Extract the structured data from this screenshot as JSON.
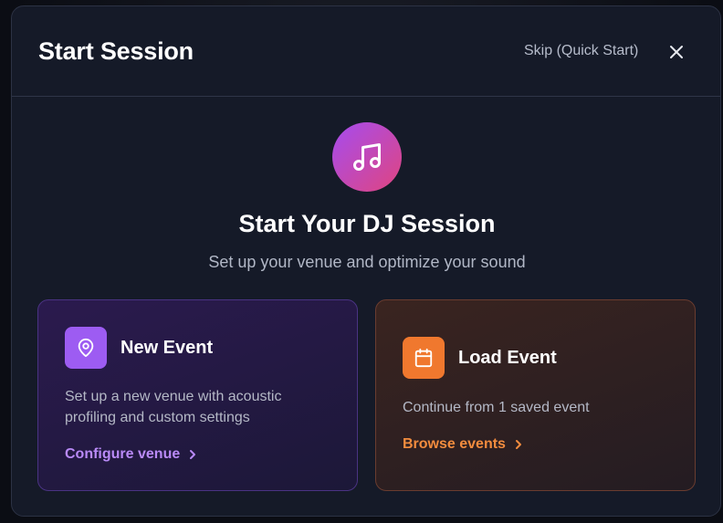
{
  "modal": {
    "title": "Start Session",
    "skip_label": "Skip (Quick Start)"
  },
  "hero": {
    "title": "Start Your DJ Session",
    "subtitle": "Set up your venue and optimize your sound",
    "icon": "music-note-icon"
  },
  "cards": [
    {
      "title": "New Event",
      "description": "Set up a new venue with acoustic profiling and custom settings",
      "action": "Configure venue",
      "icon": "map-pin-icon",
      "accent": "#9d5cf2"
    },
    {
      "title": "Load Event",
      "description": "Continue from 1 saved event",
      "action": "Browse events",
      "icon": "calendar-icon",
      "accent": "#f0782e"
    }
  ],
  "colors": {
    "modal_bg": "#151a28",
    "hero_gradient_start": "#a54cf0",
    "hero_gradient_end": "#e0457f"
  }
}
